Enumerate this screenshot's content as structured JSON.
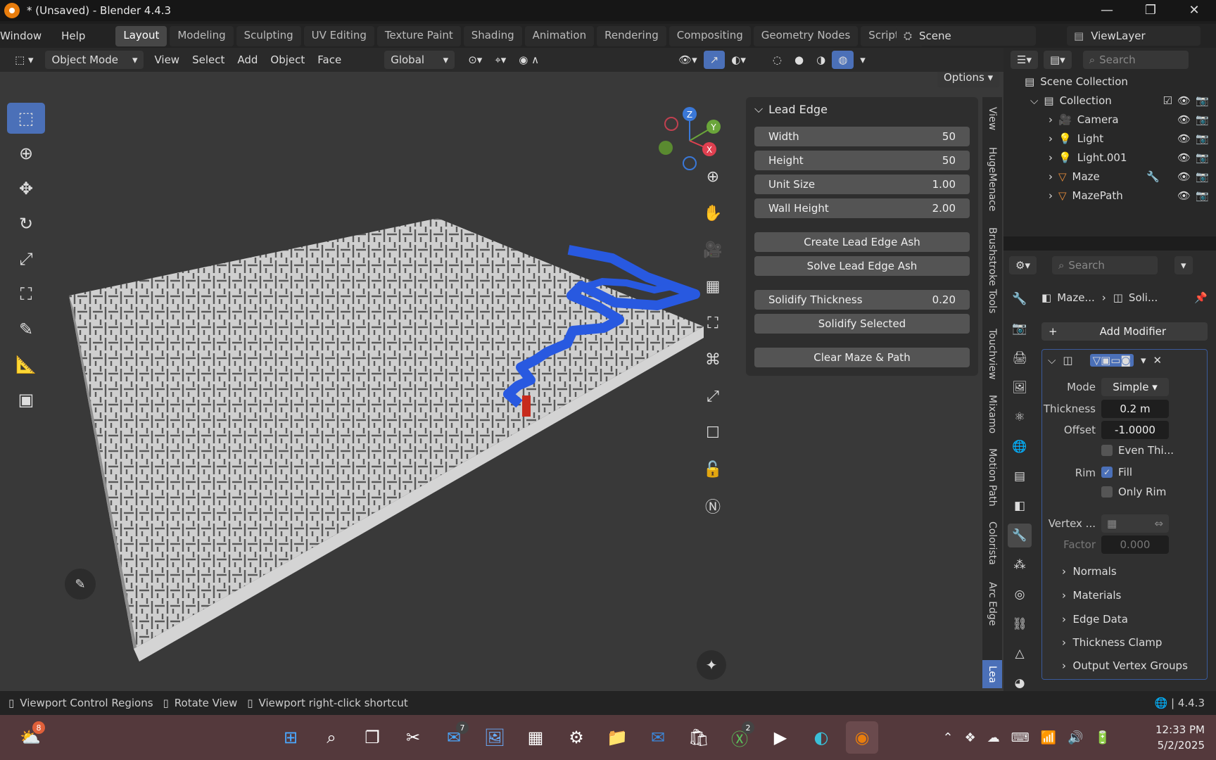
{
  "window": {
    "title": "* (Unsaved) - Blender 4.4.3",
    "controls": [
      "—",
      "❐",
      "✕"
    ]
  },
  "menu": {
    "items": [
      "Window",
      "Help"
    ]
  },
  "workspaces": [
    "Layout",
    "Modeling",
    "Sculpting",
    "UV Editing",
    "Texture Paint",
    "Shading",
    "Animation",
    "Rendering",
    "Compositing",
    "Geometry Nodes",
    "Scripting"
  ],
  "active_workspace": "Layout",
  "scene": {
    "name": "Scene",
    "view_layer": "ViewLayer"
  },
  "viewport_header": {
    "mode": "Object Mode",
    "menus": [
      "View",
      "Select",
      "Add",
      "Object",
      "Face"
    ],
    "orientation": "Global",
    "options": "Options"
  },
  "gizmo_axes": {
    "z": "Z",
    "y": "Y",
    "x": "X"
  },
  "npanel": {
    "title": "Lead Edge",
    "props": [
      {
        "label": "Width",
        "value": "50"
      },
      {
        "label": "Height",
        "value": "50"
      },
      {
        "label": "Unit Size",
        "value": "1.00"
      },
      {
        "label": "Wall Height",
        "value": "2.00"
      }
    ],
    "create_btn": "Create Lead Edge Ash",
    "solve_btn": "Solve Lead Edge Ash",
    "solidify": {
      "label": "Solidify Thickness",
      "value": "0.20"
    },
    "solidify_btn": "Solidify Selected",
    "clear_btn": "Clear Maze & Path"
  },
  "side_tabs": [
    "View",
    "HugeMenace",
    "Brushstroke Tools",
    "Touchview",
    "Mixamo",
    "Motion Path",
    "Colorista",
    "Arc Edge",
    "Lea"
  ],
  "outliner": {
    "search": "Search",
    "root": "Scene Collection",
    "collection": "Collection",
    "items": [
      "Camera",
      "Light",
      "Light.001",
      "Maze",
      "MazePath"
    ]
  },
  "properties": {
    "search": "Search",
    "breadcrumb": [
      "Maze...",
      "Soli..."
    ],
    "add_modifier": "Add Modifier",
    "mode": {
      "label": "Mode",
      "value": "Simple"
    },
    "thickness": {
      "label": "Thickness",
      "value": "0.2 m"
    },
    "offset": {
      "label": "Offset",
      "value": "-1.0000"
    },
    "even": "Even Thi...",
    "rim": {
      "label": "Rim",
      "fill": "Fill",
      "only": "Only Rim"
    },
    "vertex": "Vertex ...",
    "factor": {
      "label": "Factor",
      "value": "0.000"
    },
    "sections": [
      "Normals",
      "Materials",
      "Edge Data",
      "Thickness Clamp",
      "Output Vertex Groups"
    ]
  },
  "status": {
    "items": [
      "Viewport Control Regions",
      "Rotate View",
      "Viewport right-click shortcut"
    ],
    "version": "4.4.3"
  },
  "taskbar": {
    "weather_badge": "8",
    "mail_badge": "7",
    "xbox_badge": "2",
    "time": "12:33 PM",
    "date": "5/2/2025"
  }
}
